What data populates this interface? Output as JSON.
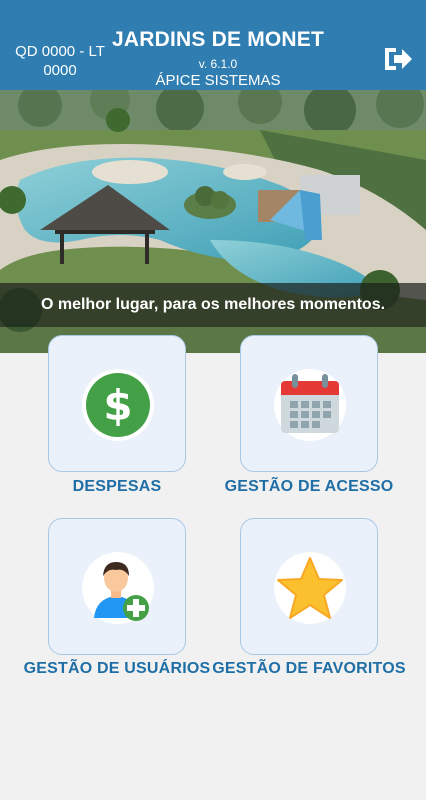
{
  "header": {
    "unit": "QD 0000 - LT 0000",
    "title": "JARDINS DE MONET",
    "version": "v. 6.1.0",
    "company": "ÁPICE SISTEMAS",
    "logout_icon": "logout-icon"
  },
  "banner": {
    "tagline": "O melhor lugar, para os melhores momentos."
  },
  "menu": [
    {
      "label": "DESPESAS",
      "icon": "dollar-icon",
      "color": "#43a047"
    },
    {
      "label": "GESTÃO DE ACESSO",
      "icon": "calendar-icon",
      "color": "#e53935"
    },
    {
      "label": "GESTÃO DE USUÁRIOS",
      "icon": "add-user-icon",
      "color": "#43a047"
    },
    {
      "label": "GESTÃO DE FAVORITOS",
      "icon": "star-icon",
      "color": "#fbc02d"
    }
  ],
  "colors": {
    "header_bg": "#2f7db1",
    "label": "#1f6fa6",
    "tile_bg": "#eaf1fa",
    "tile_border": "#a9c8e6"
  }
}
